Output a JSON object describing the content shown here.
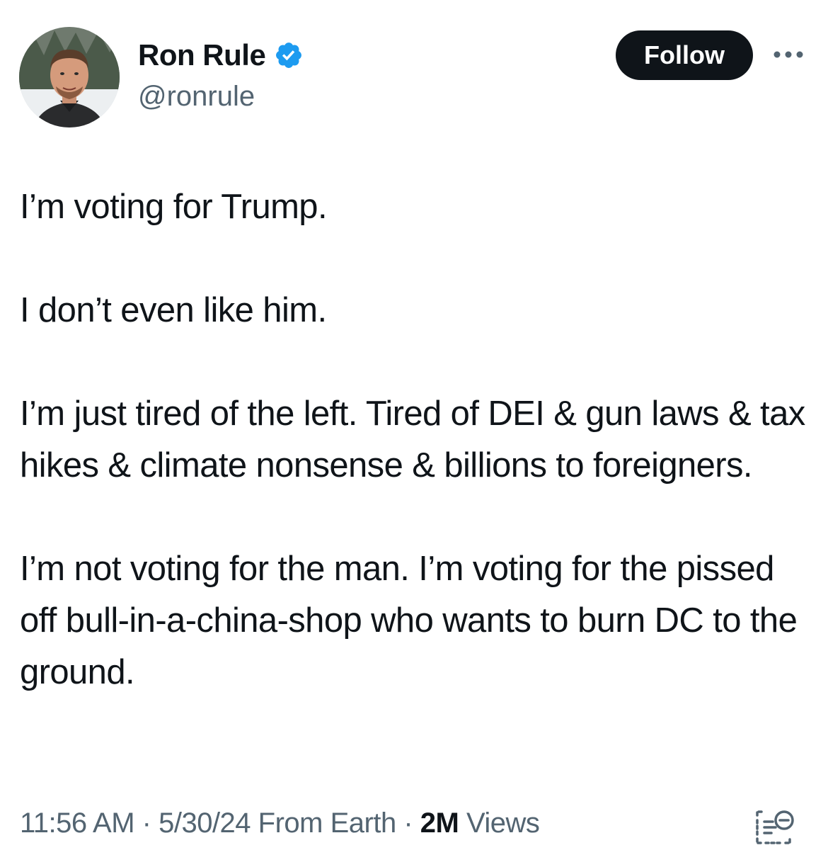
{
  "author": {
    "display_name": "Ron Rule",
    "handle": "@ronrule",
    "verified_icon": "verified-badge-icon",
    "avatar": "profile-photo"
  },
  "actions": {
    "follow_label": "Follow",
    "more_icon": "more-options-icon"
  },
  "tweet": {
    "paragraphs": [
      "I’m voting for Trump.",
      "I don’t even like him.",
      "I’m just tired of the left. Tired of DEI & gun laws & tax hikes & climate nonsense & billions to foreigners.",
      "I’m not voting for the man. I’m voting for the pissed off bull-in-a-china-shop who wants to burn DC to the ground."
    ]
  },
  "meta": {
    "time": "11:56 AM",
    "sep1": " · ",
    "date": "5/30/24",
    "source": " From Earth",
    "sep2": " · ",
    "views_count": "2M",
    "views_label": " Views",
    "analytics_icon": "post-analytics-icon"
  },
  "colors": {
    "text": "#0f1419",
    "secondary": "#536471",
    "verified": "#1d9bf0",
    "button": "#0f1419"
  }
}
